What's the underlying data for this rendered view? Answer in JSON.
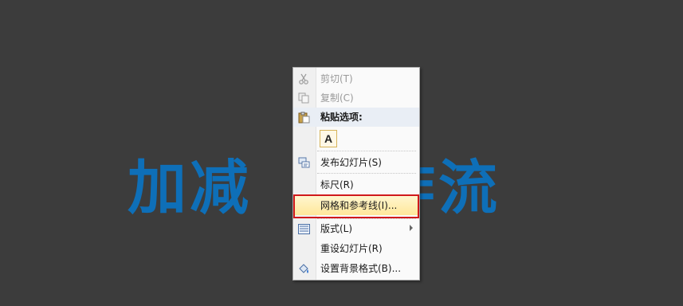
{
  "slide": {
    "title": "加减　　作流"
  },
  "menu": {
    "cut": "剪切(T)",
    "copy": "复制(C)",
    "paste_options": "粘贴选项:",
    "paste_keep_text": "A",
    "publish_slides": "发布幻灯片(S)",
    "ruler": "标尺(R)",
    "grid_guides": "网格和参考线(I)...",
    "layout": "版式(L)",
    "reset_slide": "重设幻灯片(R)",
    "format_background": "设置背景格式(B)..."
  },
  "colors": {
    "slide_background": "#3c3c3c",
    "title_color": "#0e6fb8",
    "highlight_border": "#d0191b"
  },
  "icons": {
    "cut": "scissors-icon",
    "copy": "copy-icon",
    "paste": "clipboard-icon",
    "publish": "publish-slides-icon",
    "layout": "layout-icon",
    "format_background": "paint-bucket-icon"
  }
}
